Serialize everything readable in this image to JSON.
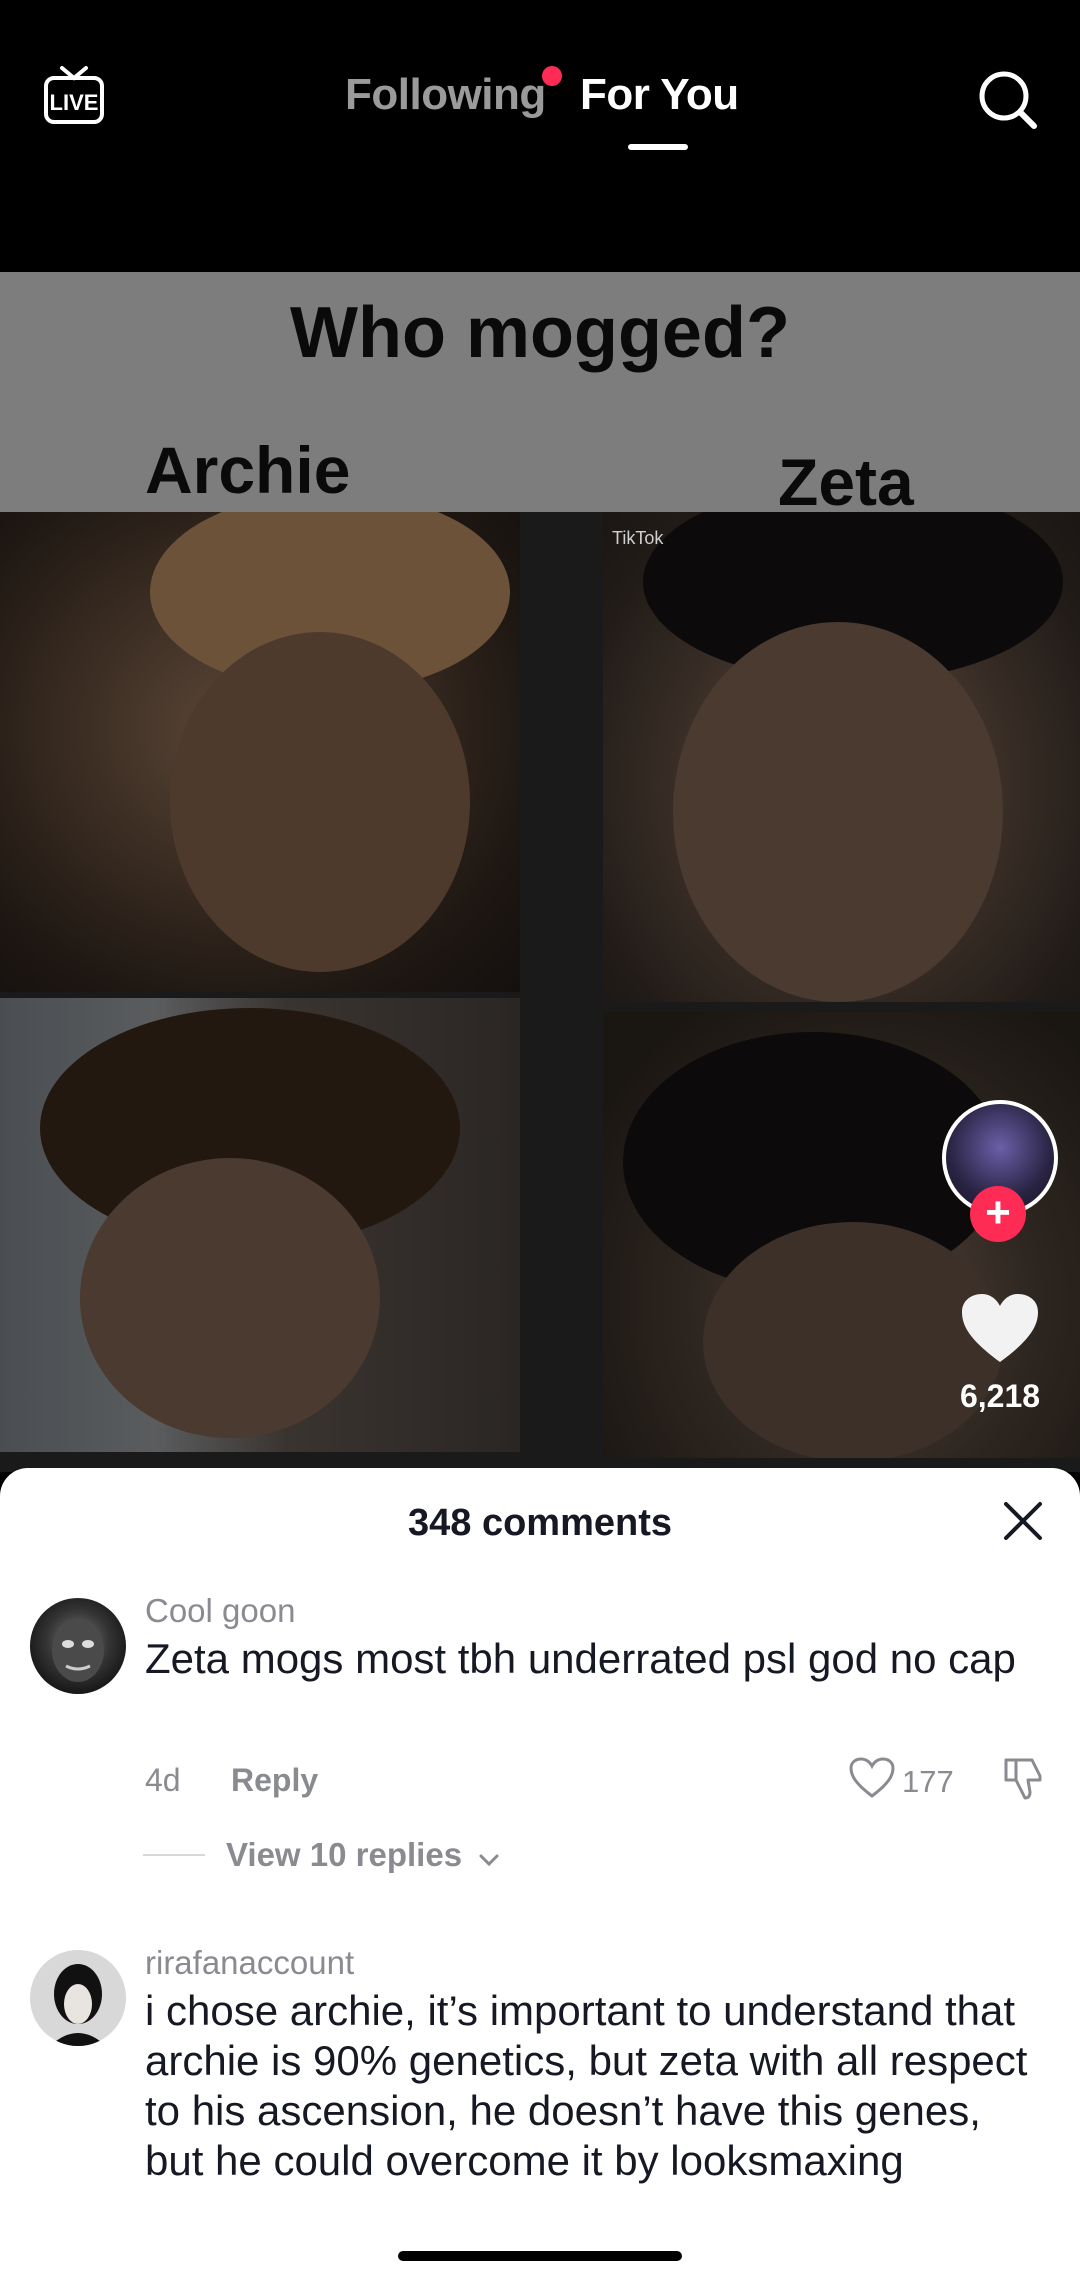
{
  "top_nav": {
    "live_icon": "live-tv-icon",
    "tabs": [
      {
        "label": "Following",
        "has_notification_dot": true
      },
      {
        "label": "For You",
        "active": true
      }
    ],
    "search_icon": "search-icon"
  },
  "video": {
    "title": "Who mogged?",
    "left_label": "Archie",
    "right_label": "Zeta",
    "watermark": "TikTok"
  },
  "side_rail": {
    "like_count": "6,218"
  },
  "comments_sheet": {
    "title": "348 comments",
    "comments": [
      {
        "username": "Cool goon",
        "text": "Zeta mogs most tbh underrated psl god no cap",
        "age": "4d",
        "reply_label": "Reply",
        "likes": "177",
        "view_replies": "View 10 replies"
      },
      {
        "username": "rirafanaccount",
        "text": "i chose archie, it’s important to understand that archie is 90% genetics, but zeta with all respect to his ascension, he doesn’t have this genes, but he could overcome it by looksmaxing"
      }
    ]
  },
  "colors": {
    "accent": "#fe2c55",
    "text_primary": "#161823",
    "text_secondary": "#8a8b91"
  }
}
